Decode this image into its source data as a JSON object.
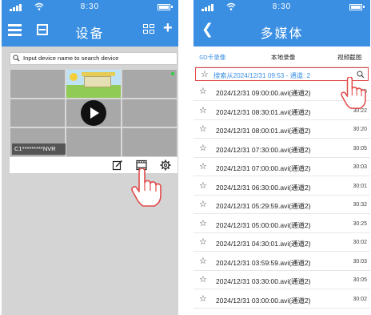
{
  "status_bar": {
    "time": "8:30"
  },
  "left_screen": {
    "title": "设备",
    "search": {
      "placeholder": "Input device name to search device"
    },
    "preview": {
      "device_label": "C1*********NVR"
    },
    "icons": [
      "menu-icon",
      "scan-icon",
      "grid-view-icon",
      "plus-icon",
      "edit-icon",
      "film-icon",
      "settings-icon",
      "pointer-hand-icon"
    ]
  },
  "right_screen": {
    "title": "多媒体",
    "tabs": [
      {
        "label": "SD卡录像",
        "active": true
      },
      {
        "label": "本地录像",
        "active": false
      },
      {
        "label": "视频截图",
        "active": false
      }
    ],
    "search_bar": {
      "text": "搜索从2024/12/31  09:53  -  通道:  2"
    },
    "recordings": [
      {
        "name": "2024/12/31  09:00:00.avi(通道2)",
        "duration": "30:15"
      },
      {
        "name": "2024/12/31  08:30:01.avi(通道2)",
        "duration": "30:22"
      },
      {
        "name": "2024/12/31  08:00:01.avi(通道2)",
        "duration": "30:20"
      },
      {
        "name": "2024/12/31  07:30:00.avi(通道2)",
        "duration": "30:05"
      },
      {
        "name": "2024/12/31  07:00:00.avi(通道2)",
        "duration": "30:03"
      },
      {
        "name": "2024/12/31  06:30:00.avi(通道2)",
        "duration": "30:01"
      },
      {
        "name": "2024/12/31  05:29:59.avi(通道2)",
        "duration": "30:32"
      },
      {
        "name": "2024/12/31  05:00:00.avi(通道2)",
        "duration": "30:25"
      },
      {
        "name": "2024/12/31  04:30:01.avi(通道2)",
        "duration": "30:02"
      },
      {
        "name": "2024/12/31  03:59:59.avi(通道2)",
        "duration": "30:03"
      },
      {
        "name": "2024/12/31  03:30:00.avi(通道2)",
        "duration": "30:05"
      },
      {
        "name": "2024/12/31  03:00:00.avi(通道2)",
        "duration": "30:02"
      }
    ]
  },
  "colors": {
    "accent": "#3a8fe2",
    "highlight_border": "#e14a4a",
    "background_gray": "#d4d4d4"
  }
}
